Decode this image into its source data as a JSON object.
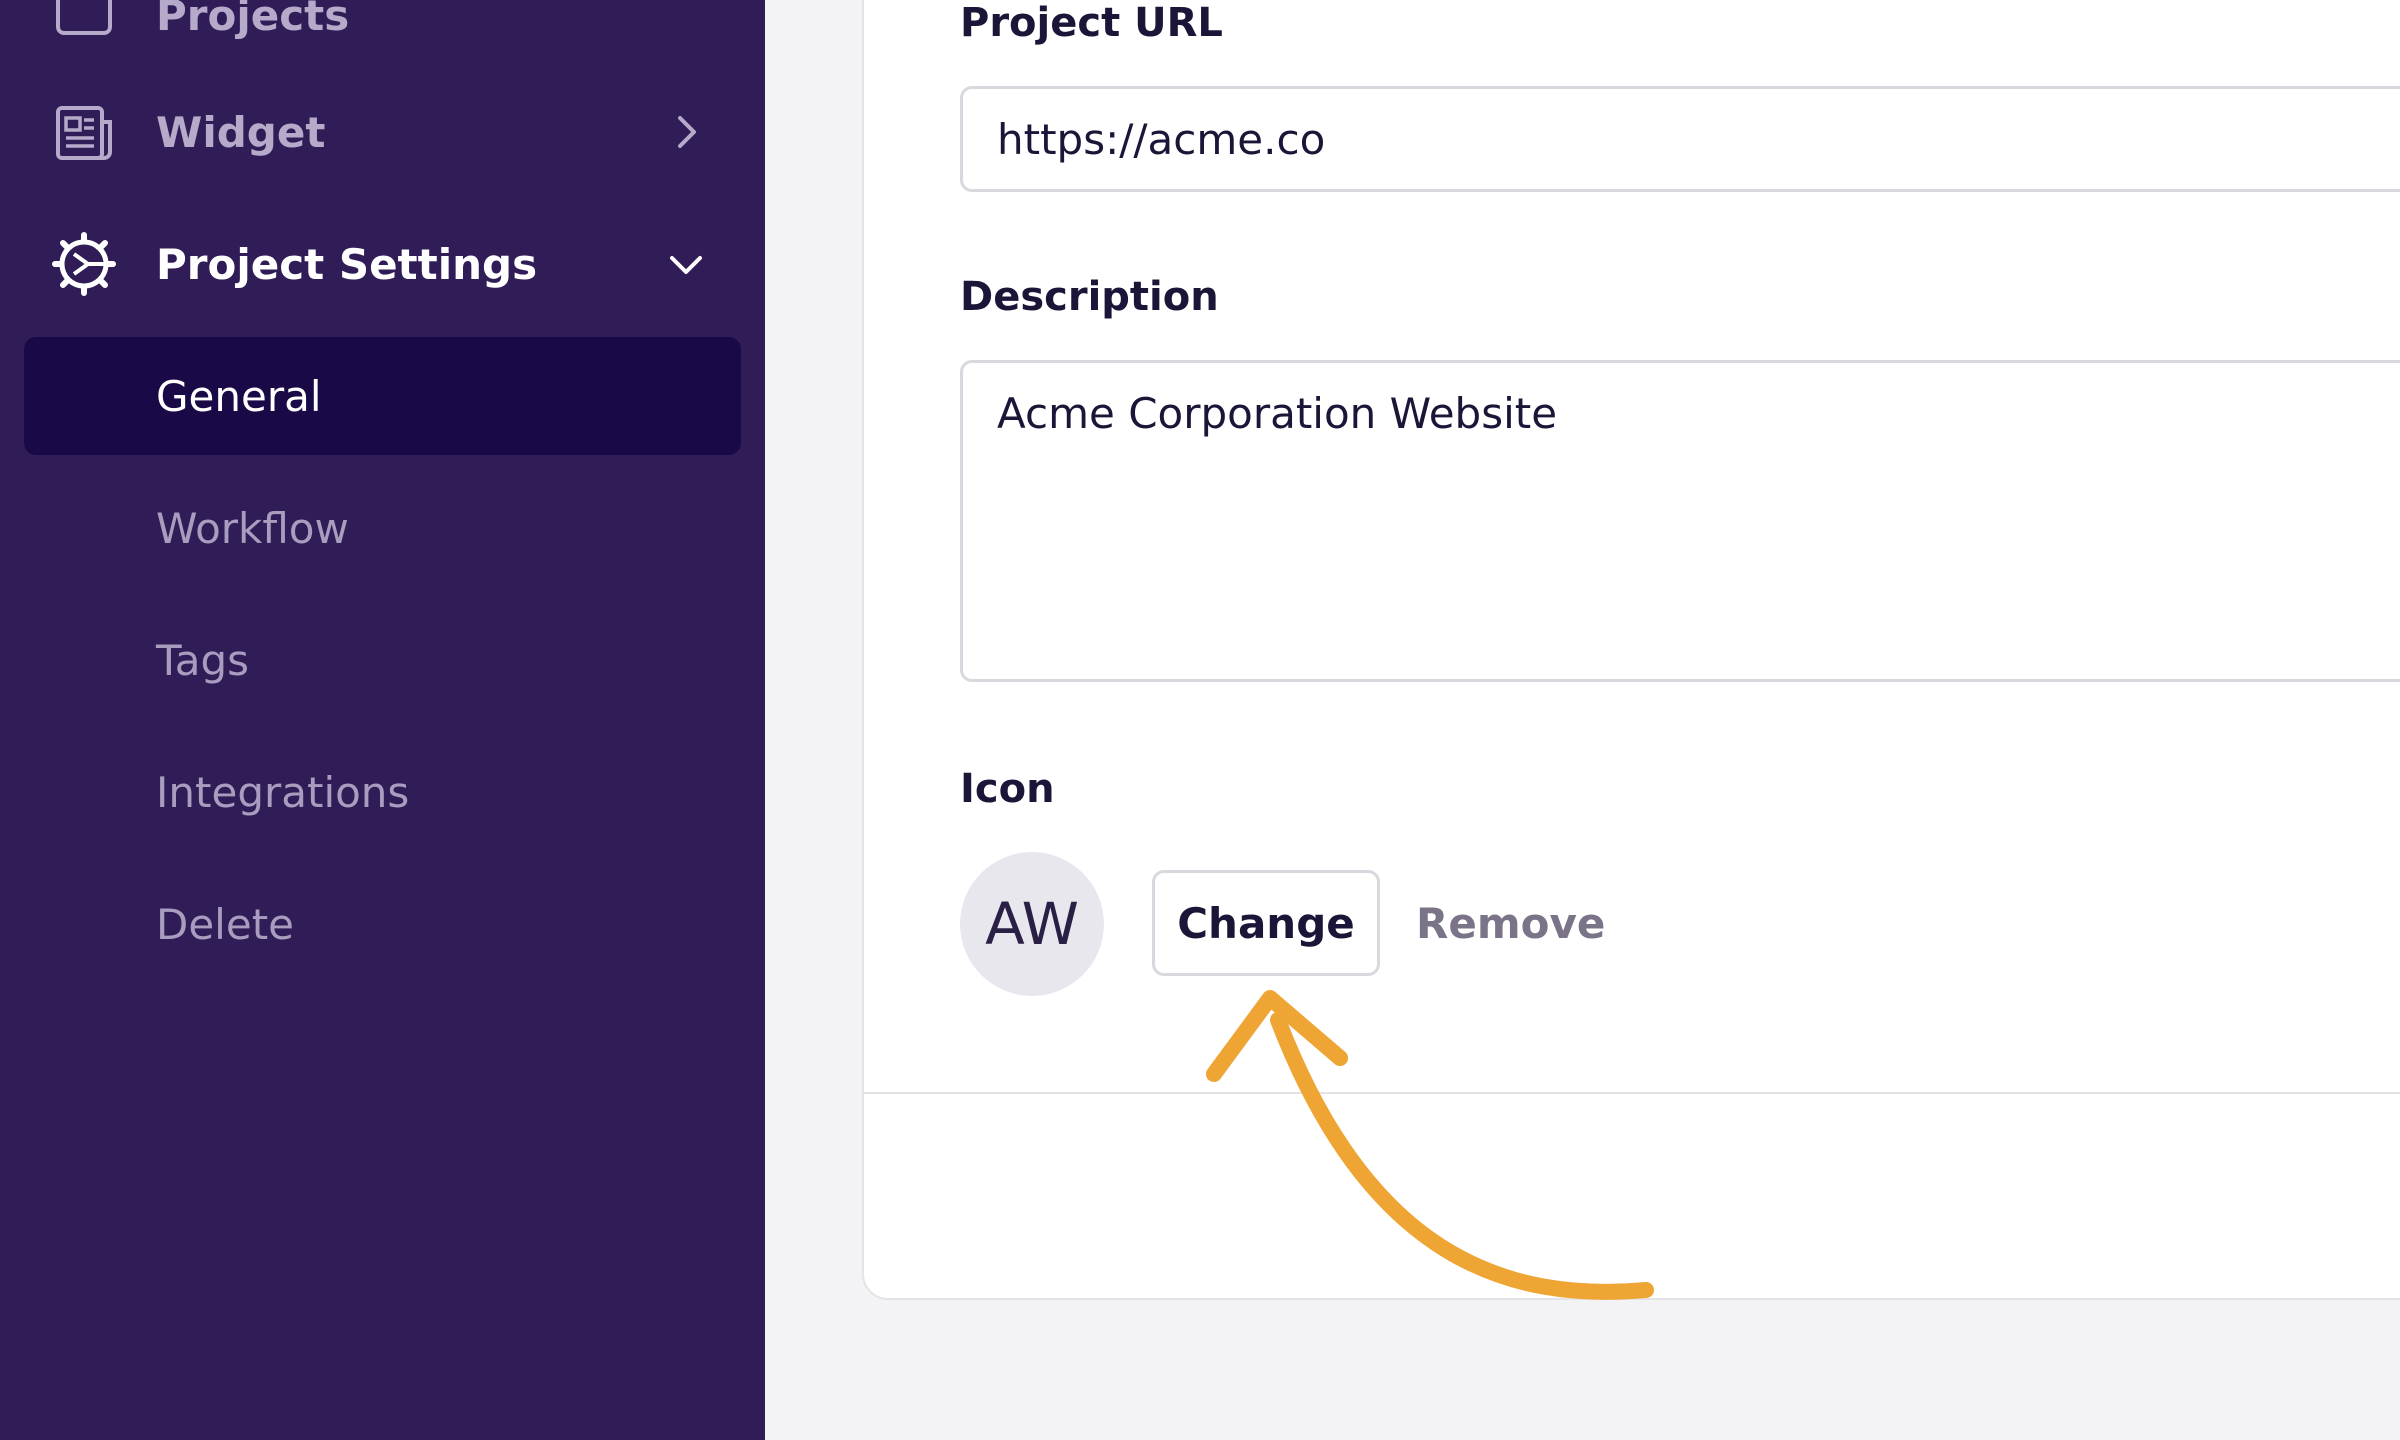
{
  "sidebar": {
    "projects_label": "Projects",
    "widget_label": "Widget",
    "settings_label": "Project Settings",
    "sub_items": [
      {
        "label": "General"
      },
      {
        "label": "Workflow"
      },
      {
        "label": "Tags"
      },
      {
        "label": "Integrations"
      },
      {
        "label": "Delete"
      }
    ]
  },
  "form": {
    "url_label": "Project URL",
    "url_value": "https://acme.co",
    "description_label": "Description",
    "description_value": "Acme Corporation Website",
    "icon_label": "Icon",
    "avatar_initials": "AW",
    "change_label": "Change",
    "remove_label": "Remove"
  },
  "colors": {
    "sidebar_bg": "#301c56",
    "active_bg": "#1a0947",
    "arrow": "#eea534"
  },
  "icons": [
    "projects-icon",
    "widget-icon",
    "chevron-right-icon",
    "settings-gear-icon",
    "chevron-down-icon",
    "annotation-arrow"
  ]
}
